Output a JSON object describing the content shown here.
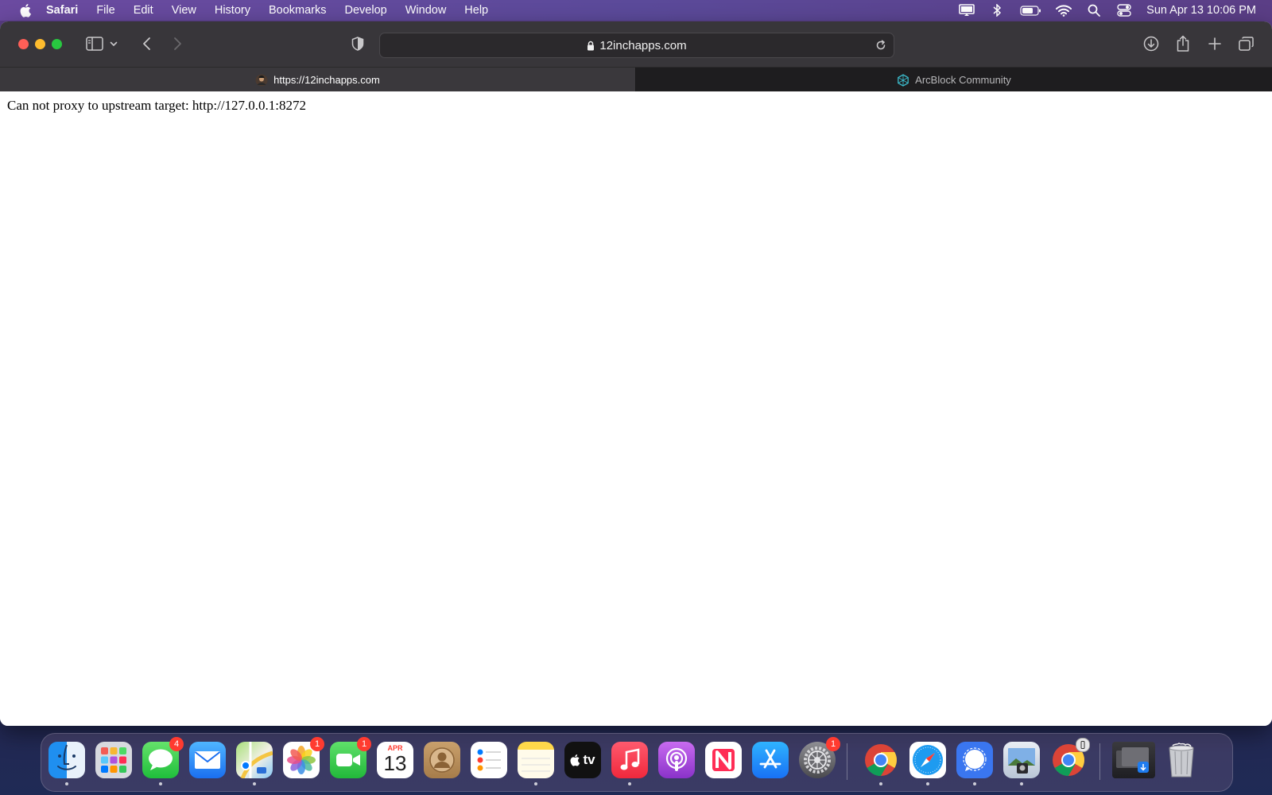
{
  "menubar": {
    "apple_icon": "apple-logo-icon",
    "items": [
      "Safari",
      "File",
      "Edit",
      "View",
      "History",
      "Bookmarks",
      "Develop",
      "Window",
      "Help"
    ],
    "status_icons": [
      "display-icon",
      "bluetooth-icon",
      "battery-icon",
      "wifi-icon",
      "search-icon",
      "control-center-icon"
    ],
    "clock": "Sun Apr 13  10:06 PM"
  },
  "toolbar": {
    "url": "12inchapps.com",
    "icons": [
      "sidebar-icon",
      "chevron-down-icon",
      "back-icon",
      "forward-icon",
      "privacy-shield-icon",
      "download-icon",
      "share-icon",
      "new-tab-icon",
      "tab-overview-icon"
    ]
  },
  "tabs": [
    {
      "label": "https://12inchapps.com",
      "active": true,
      "favicon": "avatar-favicon"
    },
    {
      "label": "ArcBlock Community",
      "active": false,
      "favicon": "arcblock-favicon"
    }
  ],
  "content": {
    "error_text": "Can not proxy to upstream target: http://127.0.0.1:8272"
  },
  "dock": {
    "apps": [
      {
        "name": "Finder",
        "icon": "finder-icon",
        "running": true
      },
      {
        "name": "Launchpad",
        "icon": "launchpad-icon",
        "running": false
      },
      {
        "name": "Messages",
        "icon": "messages-icon",
        "badge": "4",
        "running": true
      },
      {
        "name": "Mail",
        "icon": "mail-icon",
        "running": false
      },
      {
        "name": "Maps",
        "icon": "maps-icon",
        "running": true
      },
      {
        "name": "Photos",
        "icon": "photos-icon",
        "badge": "1",
        "running": false
      },
      {
        "name": "FaceTime",
        "icon": "facetime-icon",
        "badge": "1",
        "running": false
      },
      {
        "name": "Calendar",
        "icon": "calendar-icon",
        "month": "APR",
        "day": "13",
        "running": false
      },
      {
        "name": "Contacts",
        "icon": "contacts-icon",
        "running": false
      },
      {
        "name": "Reminders",
        "icon": "reminders-icon",
        "running": false
      },
      {
        "name": "Notes",
        "icon": "notes-icon",
        "running": true
      },
      {
        "name": "TV",
        "icon": "tv-icon",
        "label": "tv",
        "running": false
      },
      {
        "name": "Music",
        "icon": "music-icon",
        "running": true
      },
      {
        "name": "Podcasts",
        "icon": "podcasts-icon",
        "running": false
      },
      {
        "name": "News",
        "icon": "news-icon",
        "running": false
      },
      {
        "name": "App Store",
        "icon": "app-store-icon",
        "running": false
      },
      {
        "name": "System Preferences",
        "icon": "system-preferences-icon",
        "badge": "1",
        "running": false
      },
      {
        "name": "Chrome",
        "icon": "chrome-icon",
        "running": true
      },
      {
        "name": "Safari",
        "icon": "safari-icon",
        "running": true
      },
      {
        "name": "Signal",
        "icon": "signal-icon",
        "running": true
      },
      {
        "name": "Preview",
        "icon": "preview-icon",
        "running": true
      },
      {
        "name": "Chrome Beta",
        "icon": "chrome-beta-icon",
        "running": false
      },
      {
        "name": "Downloads",
        "icon": "downloads-stack-icon",
        "running": false
      },
      {
        "name": "Trash",
        "icon": "trash-icon",
        "running": false
      }
    ]
  }
}
